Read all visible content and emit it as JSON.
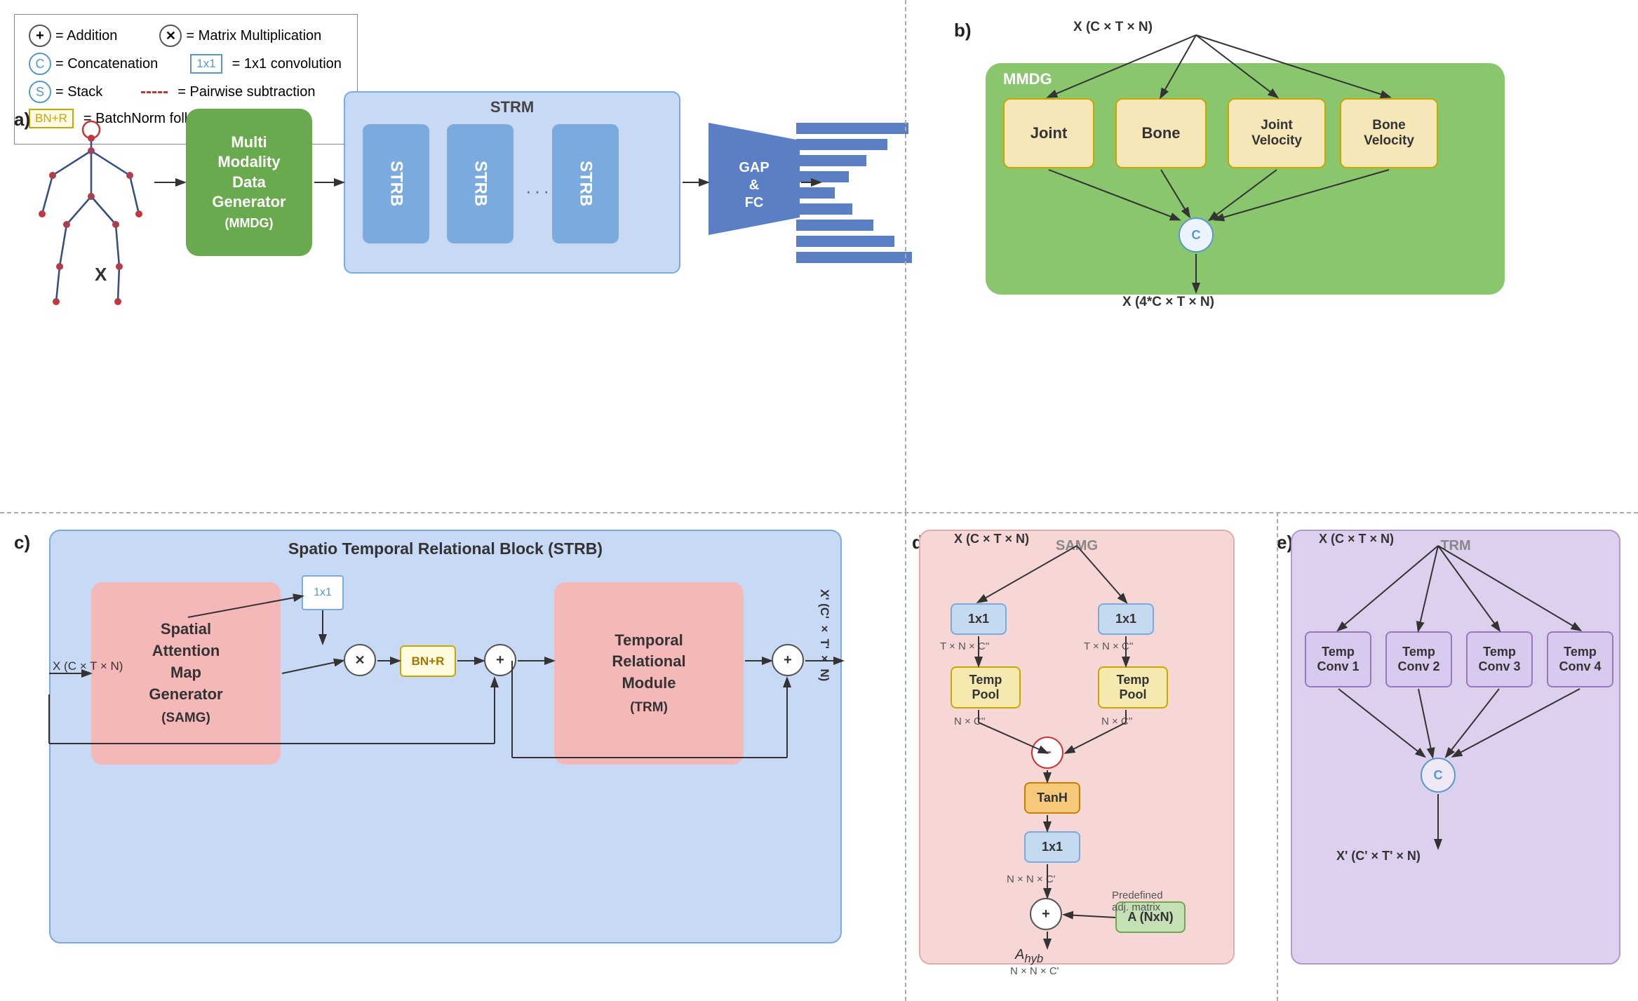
{
  "legend": {
    "items": [
      {
        "icon": "plus-circle",
        "label": "= Addition"
      },
      {
        "icon": "matrix-mult",
        "label": "= Matrix Multiplication"
      },
      {
        "icon": "concat-c",
        "label": "= Concatenation"
      },
      {
        "icon": "conv-box",
        "label": "= 1x1 convolution"
      },
      {
        "icon": "stack-s",
        "label": "= Stack"
      },
      {
        "icon": "pairwise-dash",
        "label": "= Pairwise subtraction"
      },
      {
        "icon": "bnr-box",
        "label": "= BatchNorm followed by ReLU"
      }
    ],
    "addition_label": "= Addition",
    "matrix_mult_label": "= Matrix Multiplication",
    "concat_label": "= Concatenation",
    "conv_label": "= 1x1 convolution",
    "stack_label": "= Stack",
    "pairwise_label": "= Pairwise subtraction",
    "bnr_label": "= BatchNorm followed by ReLU",
    "conv_box_text": "1x1"
  },
  "sections": {
    "a": {
      "label": "a)",
      "skeleton_label": "X",
      "mmdg": {
        "line1": "Multi",
        "line2": "Modality",
        "line3": "Data",
        "line4": "Generator",
        "line5": "(MMDG)"
      },
      "strm_label": "STRM",
      "strb_labels": [
        "STRB",
        "STRB",
        "STRB"
      ],
      "gap_label": "GAP\n& \nFC"
    },
    "b": {
      "label": "b)",
      "input_label": "X (C × T × N)",
      "mmdg_label": "MMDG",
      "modal_boxes": [
        "Joint",
        "Bone",
        "Joint\nVelocity",
        "Bone\nVelocity"
      ],
      "concat_label": "C",
      "output_label": "X (4*C × T × N)"
    },
    "c": {
      "label": "c)",
      "title": "Spatio Temporal Relational Block (STRB)",
      "input_label": "X (C × T × N)",
      "samg_title": "Spatial\nAttention\nMap\nGenerator",
      "samg_abbr": "(SAMG)",
      "trm_title": "Temporal\nRelational\nModule",
      "trm_abbr": "(TRM)",
      "bnr_label": "BN+R",
      "output_label": "X' (C' × T' × N)",
      "conv_label": "1x1"
    },
    "d": {
      "label": "d)",
      "input_label": "X (C × T × N)",
      "samg_label": "SAMG",
      "conv1_label": "1x1",
      "conv2_label": "1x1",
      "temp_pool1": "Temp\nPool",
      "temp_pool2": "Temp\nPool",
      "nc_label1": "N × C''",
      "nc_label2": "N × C''",
      "tnc_label1": "T × N × C''",
      "tnc_label2": "T × N × C''",
      "tanh_label": "TanH",
      "conv3_label": "1x1",
      "minus_label": "−",
      "plus_label": "+",
      "a_box": "A (NxN)",
      "predefined_label": "Predefined\nadj. matrix",
      "a_hyb_label": "A_hyb",
      "nxnxcp_label": "N × N × C'"
    },
    "e": {
      "label": "e)",
      "input_label": "X (C × T × N)",
      "trm_label": "TRM",
      "temp_convs": [
        "Temp\nConv 1",
        "Temp\nConv 2",
        "Temp\nConv 3",
        "Temp\nConv 4"
      ],
      "concat_label": "C",
      "output_label": "X' (C' × T' × N)"
    }
  }
}
